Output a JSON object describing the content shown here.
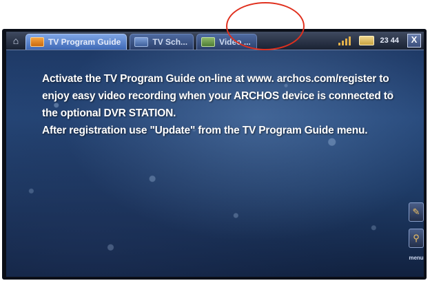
{
  "topbar": {
    "home_icon": "home-icon",
    "tabs": [
      {
        "label": "TV Program Guide",
        "icon": "tv-guide-icon",
        "active": true
      },
      {
        "label": "TV Sch...",
        "icon": "tv-schedule-icon",
        "active": false
      },
      {
        "label": "Video ...",
        "icon": "video-icon",
        "active": false
      }
    ],
    "status": {
      "signal_icon": "signal-icon",
      "battery_icon": "battery-icon",
      "time": "23 44"
    },
    "close_label": "X"
  },
  "message": {
    "paragraph1": "Activate the TV Program Guide on-line at www. archos.com/register to enjoy easy video recording when your ARCHOS device is connected to the optional DVR STATION.",
    "paragraph2": "After registration use \"Update\" from the TV Program Guide menu."
  },
  "side_toolbar": {
    "buttons": [
      {
        "icon": "guide-help-icon"
      },
      {
        "icon": "zoom-icon"
      }
    ],
    "menu_label": "menu"
  },
  "annotation": {
    "highlight": "red-circle-around-video-tab",
    "color": "#e0301e"
  }
}
